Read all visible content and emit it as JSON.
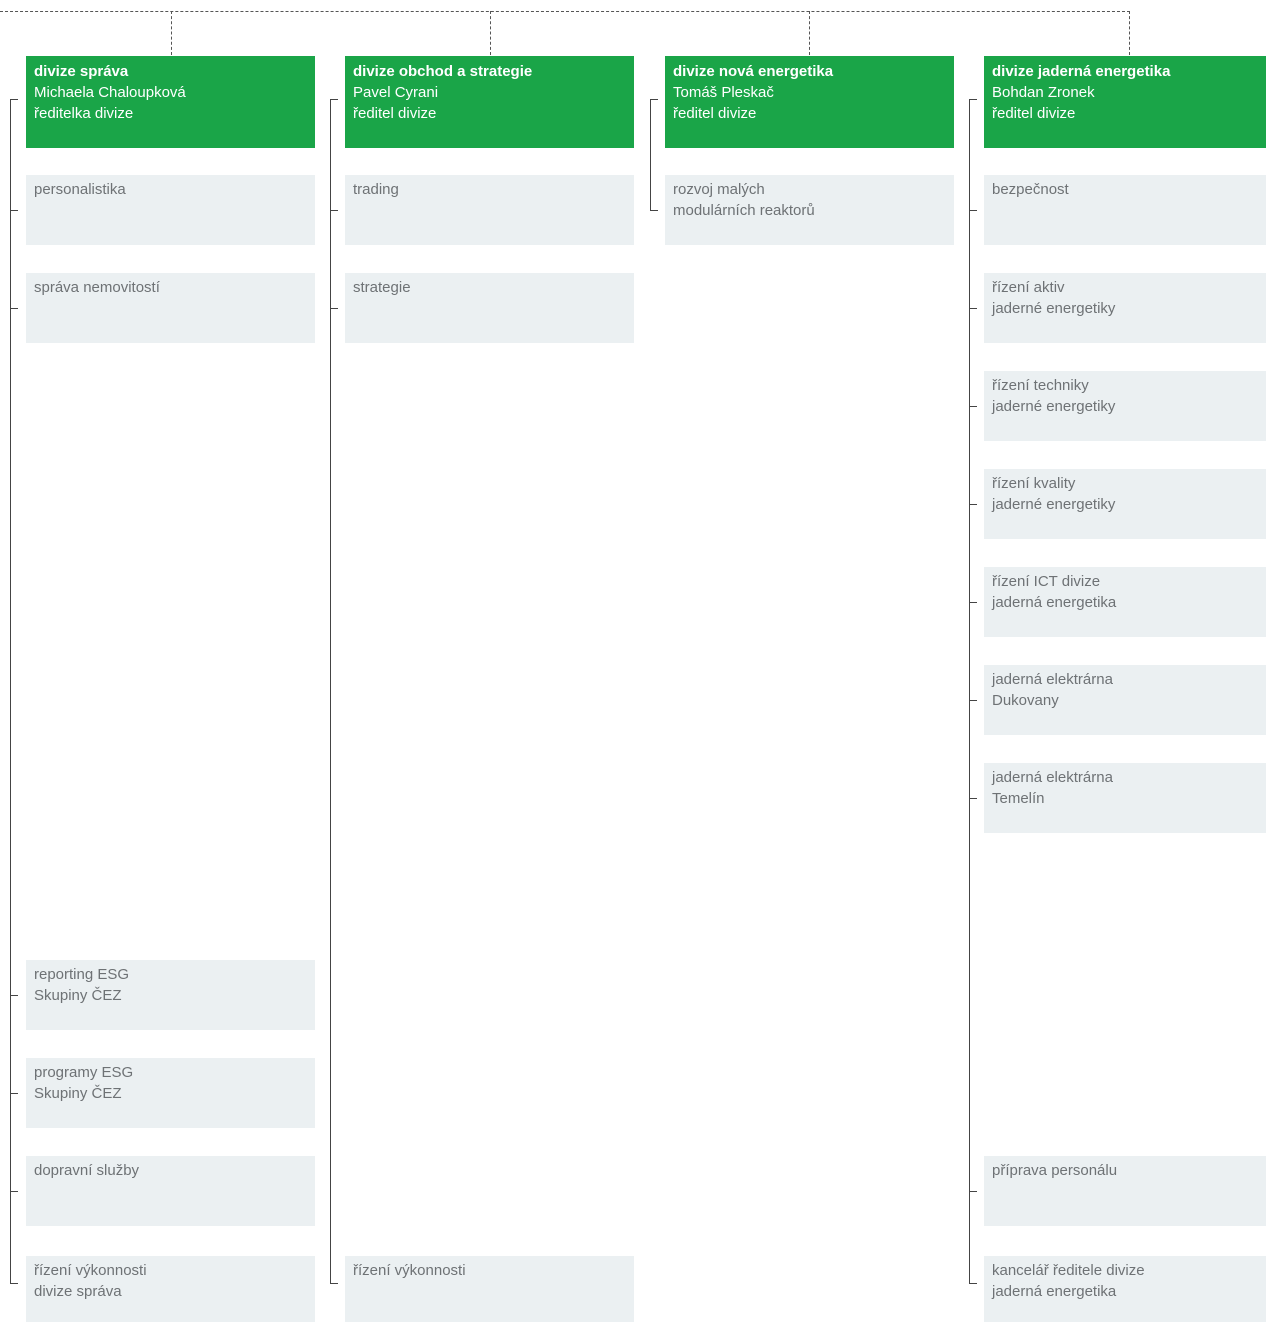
{
  "colors": {
    "head_bg": "#1aa548",
    "unit_bg": "#ebf0f2",
    "unit_text": "#6e7275"
  },
  "divisions": [
    {
      "title": "divize správa",
      "name": "Michaela Chaloupková",
      "role": "ředitelka divize",
      "units": [
        "personalistika",
        "správa nemovitostí",
        "reporting ESG\nSkupiny ČEZ",
        "programy ESG\nSkupiny ČEZ",
        "dopravní služby",
        "řízení výkonnosti\ndivize správa"
      ]
    },
    {
      "title": "divize obchod a strategie",
      "name": "Pavel Cyrani",
      "role": "ředitel divize",
      "units": [
        "trading",
        "strategie",
        "řízení výkonnosti"
      ]
    },
    {
      "title": "divize nová energetika",
      "name": "Tomáš Pleskač",
      "role": "ředitel divize",
      "units": [
        "rozvoj malých\nmodulárních reaktorů"
      ]
    },
    {
      "title": "divize jaderná energetika",
      "name": "Bohdan Zronek",
      "role": "ředitel divize",
      "units": [
        "bezpečnost",
        "řízení aktiv\njaderné energetiky",
        "řízení techniky\njaderné energetiky",
        "řízení kvality\njaderné energetiky",
        "řízení ICT divize\njaderná energetika",
        "jaderná elektrárna\nDukovany",
        "jaderná elektrárna\nTemelín",
        "příprava personálu",
        "kancelář ředitele divize\njaderná energetika"
      ]
    }
  ]
}
